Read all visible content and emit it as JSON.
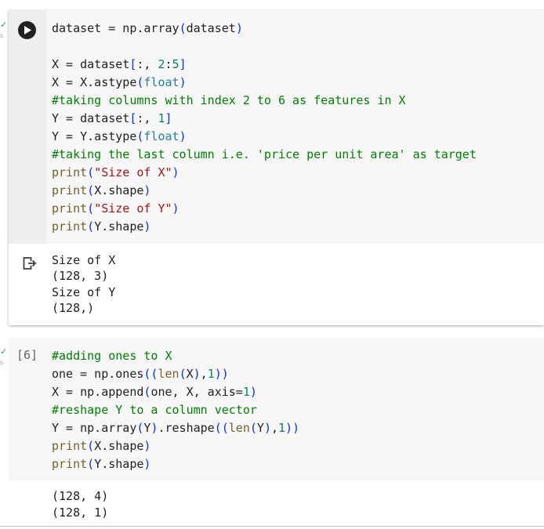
{
  "gutter": {
    "check_mark": "✓",
    "s_label": "s"
  },
  "cell1": {
    "code_lines": [
      [
        {
          "t": "dataset = np.array",
          "c": "plain"
        },
        {
          "t": "(",
          "c": "paren"
        },
        {
          "t": "dataset",
          "c": "plain"
        },
        {
          "t": ")",
          "c": "paren"
        }
      ],
      [],
      [
        {
          "t": "X = dataset",
          "c": "plain"
        },
        {
          "t": "[",
          "c": "bracket"
        },
        {
          "t": ":, ",
          "c": "plain"
        },
        {
          "t": "2",
          "c": "num"
        },
        {
          "t": ":",
          "c": "plain"
        },
        {
          "t": "5",
          "c": "num"
        },
        {
          "t": "]",
          "c": "bracket"
        }
      ],
      [
        {
          "t": "X = X.astype",
          "c": "plain"
        },
        {
          "t": "(",
          "c": "paren"
        },
        {
          "t": "float",
          "c": "method"
        },
        {
          "t": ")",
          "c": "paren"
        }
      ],
      [
        {
          "t": "#taking columns with index 2 to 6 as features in X",
          "c": "kw-green"
        }
      ],
      [
        {
          "t": "Y = dataset",
          "c": "plain"
        },
        {
          "t": "[",
          "c": "bracket"
        },
        {
          "t": ":, ",
          "c": "plain"
        },
        {
          "t": "1",
          "c": "num"
        },
        {
          "t": "]",
          "c": "bracket"
        }
      ],
      [
        {
          "t": "Y = Y.astype",
          "c": "plain"
        },
        {
          "t": "(",
          "c": "paren"
        },
        {
          "t": "float",
          "c": "method"
        },
        {
          "t": ")",
          "c": "paren"
        }
      ],
      [
        {
          "t": "#taking the last column i.e. 'price per unit area' as target",
          "c": "kw-green"
        }
      ],
      [
        {
          "t": "print",
          "c": "kw-fn"
        },
        {
          "t": "(",
          "c": "paren"
        },
        {
          "t": "\"Size of X\"",
          "c": "kw-red"
        },
        {
          "t": ")",
          "c": "paren"
        }
      ],
      [
        {
          "t": "print",
          "c": "kw-fn"
        },
        {
          "t": "(",
          "c": "paren"
        },
        {
          "t": "X.shape",
          "c": "plain"
        },
        {
          "t": ")",
          "c": "paren"
        }
      ],
      [
        {
          "t": "print",
          "c": "kw-fn"
        },
        {
          "t": "(",
          "c": "paren"
        },
        {
          "t": "\"Size of Y\"",
          "c": "kw-red"
        },
        {
          "t": ")",
          "c": "paren"
        }
      ],
      [
        {
          "t": "print",
          "c": "kw-fn"
        },
        {
          "t": "(",
          "c": "paren"
        },
        {
          "t": "Y.shape",
          "c": "plain"
        },
        {
          "t": ")",
          "c": "paren"
        }
      ]
    ],
    "output_lines": [
      "Size of X",
      "(128, 3)",
      "Size of Y",
      "(128,)"
    ]
  },
  "cell2": {
    "execution_count": "[6]",
    "code_lines": [
      [
        {
          "t": "#adding ones to X",
          "c": "kw-green"
        }
      ],
      [
        {
          "t": "one = np.ones",
          "c": "plain"
        },
        {
          "t": "((",
          "c": "paren"
        },
        {
          "t": "len",
          "c": "kw-fn"
        },
        {
          "t": "(",
          "c": "paren"
        },
        {
          "t": "X",
          "c": "plain"
        },
        {
          "t": ")",
          "c": "paren"
        },
        {
          "t": ",",
          "c": "plain"
        },
        {
          "t": "1",
          "c": "num"
        },
        {
          "t": "))",
          "c": "paren"
        }
      ],
      [
        {
          "t": "X = np.append",
          "c": "plain"
        },
        {
          "t": "(",
          "c": "paren"
        },
        {
          "t": "one, X, axis=",
          "c": "plain"
        },
        {
          "t": "1",
          "c": "num"
        },
        {
          "t": ")",
          "c": "paren"
        }
      ],
      [
        {
          "t": "#reshape Y to a column vector",
          "c": "kw-green"
        }
      ],
      [
        {
          "t": "Y = np.array",
          "c": "plain"
        },
        {
          "t": "(",
          "c": "paren"
        },
        {
          "t": "Y",
          "c": "plain"
        },
        {
          "t": ")",
          "c": "paren"
        },
        {
          "t": ".reshape",
          "c": "plain"
        },
        {
          "t": "((",
          "c": "paren"
        },
        {
          "t": "len",
          "c": "kw-fn"
        },
        {
          "t": "(",
          "c": "paren"
        },
        {
          "t": "Y",
          "c": "plain"
        },
        {
          "t": ")",
          "c": "paren"
        },
        {
          "t": ",",
          "c": "plain"
        },
        {
          "t": "1",
          "c": "num"
        },
        {
          "t": "))",
          "c": "paren"
        }
      ],
      [
        {
          "t": "print",
          "c": "kw-fn"
        },
        {
          "t": "(",
          "c": "paren"
        },
        {
          "t": "X.shape",
          "c": "plain"
        },
        {
          "t": ")",
          "c": "paren"
        }
      ],
      [
        {
          "t": "print",
          "c": "kw-fn"
        },
        {
          "t": "(",
          "c": "paren"
        },
        {
          "t": "Y.shape",
          "c": "plain"
        },
        {
          "t": ")",
          "c": "paren"
        }
      ]
    ],
    "output_lines": [
      "(128, 4)",
      "(128, 1)"
    ]
  }
}
